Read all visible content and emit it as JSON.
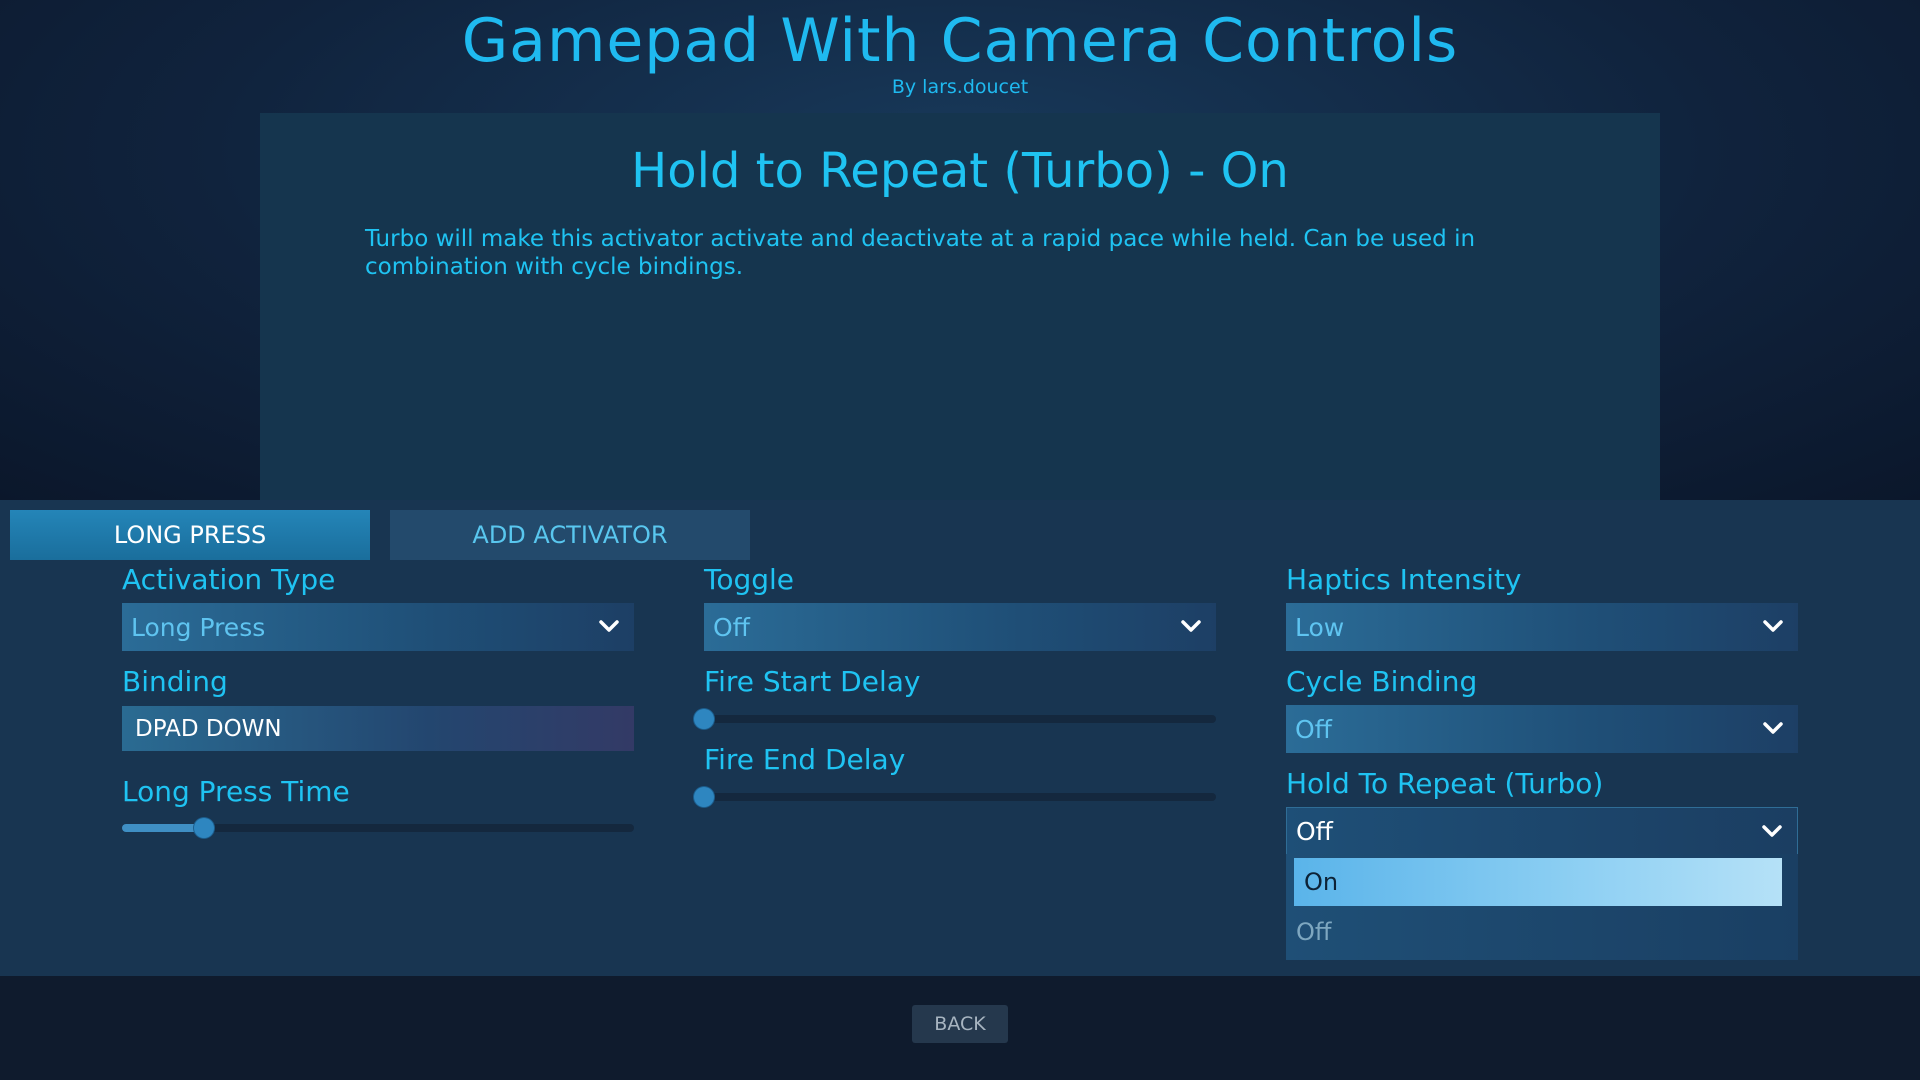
{
  "header": {
    "title": "Gamepad With Camera Controls",
    "author": "By lars.doucet"
  },
  "info": {
    "title": "Hold to Repeat (Turbo) - On",
    "description": "Turbo will make this activator activate and deactivate at a rapid pace while held.  Can be used in combination with cycle bindings."
  },
  "tabs": [
    {
      "label": "LONG PRESS",
      "active": true
    },
    {
      "label": "ADD ACTIVATOR",
      "active": false
    }
  ],
  "settings": {
    "activation_type": {
      "label": "Activation Type",
      "value": "Long Press"
    },
    "binding": {
      "label": "Binding",
      "value": "DPAD DOWN"
    },
    "long_press_time": {
      "label": "Long Press Time",
      "level": 0.16
    },
    "toggle": {
      "label": "Toggle",
      "value": "Off"
    },
    "fire_start_delay": {
      "label": "Fire Start Delay",
      "level": 0.0
    },
    "fire_end_delay": {
      "label": "Fire End Delay",
      "level": 0.0
    },
    "haptics_intensity": {
      "label": "Haptics Intensity",
      "value": "Low"
    },
    "cycle_binding": {
      "label": "Cycle Binding",
      "value": "Off"
    },
    "hold_to_repeat": {
      "label": "Hold To Repeat (Turbo)",
      "value": "Off",
      "options": [
        "On",
        "Off"
      ],
      "highlighted": "On"
    }
  },
  "footer": {
    "back_label": "BACK"
  },
  "colors": {
    "accent": "#1fc3f2",
    "panel": "#15354e",
    "highlight": "#8fd0f3"
  },
  "icons": {
    "dropdown": "chevron-down-icon"
  }
}
